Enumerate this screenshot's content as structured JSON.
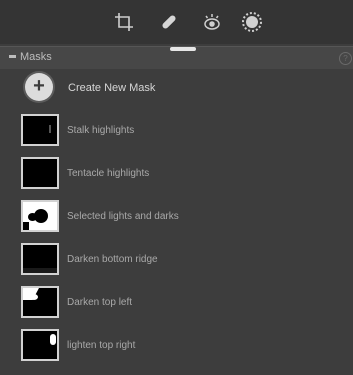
{
  "toolbar": {
    "icons": [
      "crop-icon",
      "healing-icon",
      "redeye-icon",
      "radial-filter-icon"
    ]
  },
  "masks_section": {
    "title": "Masks",
    "info_label": "?"
  },
  "create": {
    "icon": "plus-icon",
    "label": "Create New Mask"
  },
  "masks": [
    {
      "label": "Stalk highlights"
    },
    {
      "label": "Tentacle highlights"
    },
    {
      "label": "Selected lights and darks"
    },
    {
      "label": "Darken bottom ridge"
    },
    {
      "label": "Darken top left"
    },
    {
      "label": "lighten top right"
    }
  ],
  "colors": {
    "panel_bg": "#3d3d3d",
    "toolbar_bg": "#343434",
    "thumb_border": "#d2d2d2"
  }
}
